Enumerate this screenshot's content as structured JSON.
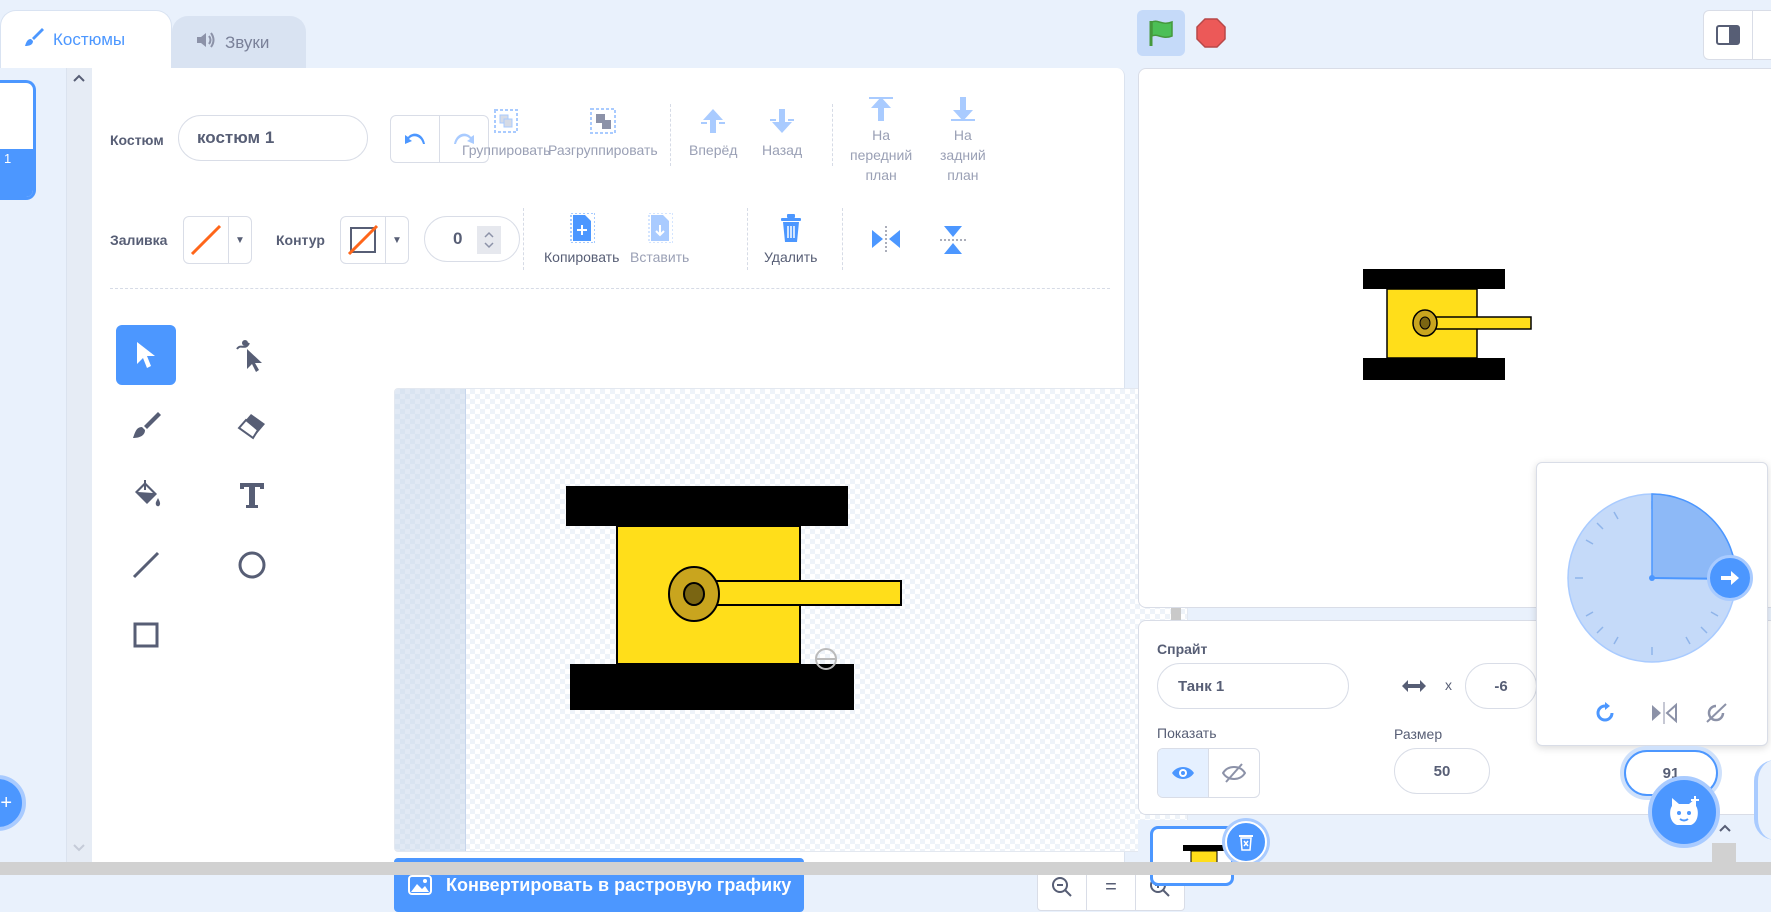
{
  "tabs": {
    "costumes": "Костюмы",
    "sounds": "Звуки"
  },
  "costume_list": {
    "selected_number": "1"
  },
  "toolbar": {
    "costume_label": "Костюм",
    "costume_name": "костюм 1",
    "group": "Группировать",
    "ungroup": "Разгруппировать",
    "forward": "Вперёд",
    "backward": "Назад",
    "front_line1": "На",
    "front_line2": "передний",
    "front_line3": "план",
    "back_line1": "На",
    "back_line2": "задний",
    "back_line3": "план",
    "fill_label": "Заливка",
    "outline_label": "Контур",
    "outline_width": "0",
    "copy": "Копировать",
    "paste": "Вставить",
    "delete": "Удалить"
  },
  "tools": [
    "select",
    "reshape",
    "brush",
    "eraser",
    "fill",
    "text",
    "line",
    "circle",
    "rectangle"
  ],
  "convert_button": "Конвертировать в растровую графику",
  "zoom": {
    "reset": "="
  },
  "sprite": {
    "label": "Спрайт",
    "name": "Танк 1",
    "x_label": "x",
    "x": "-6",
    "show_label": "Показать",
    "size_label": "Размер",
    "size": "50",
    "direction": "91"
  },
  "colors": {
    "accent": "#4c97ff",
    "tank_yellow": "#ffde1a",
    "tank_black": "#000000",
    "barrel_gold": "#c9a51e",
    "stop_red": "#ec5958",
    "flag_green": "#4cbf56"
  }
}
